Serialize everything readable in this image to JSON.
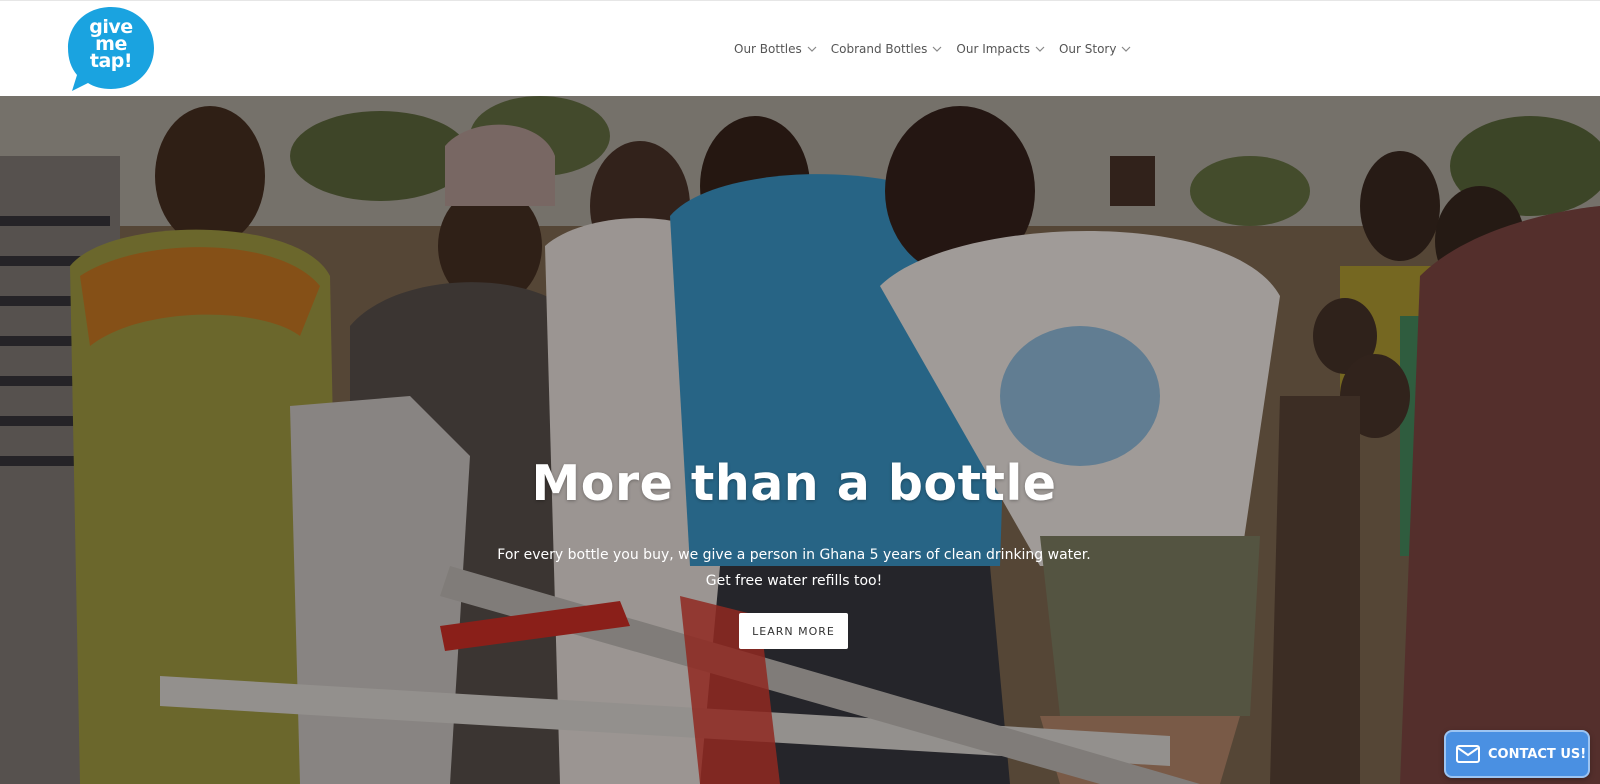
{
  "brand": {
    "logo_lines": [
      "give",
      "me",
      "tap!"
    ],
    "logo_color": "#1aa3e0"
  },
  "nav": {
    "items": [
      {
        "label": "Our Bottles",
        "icon": "chevron-down-icon"
      },
      {
        "label": "Cobrand Bottles",
        "icon": "chevron-down-icon"
      },
      {
        "label": "Our Impacts",
        "icon": "chevron-down-icon"
      },
      {
        "label": "Our Story",
        "icon": "chevron-down-icon"
      }
    ]
  },
  "hero": {
    "title": "More than a bottle",
    "subtitle_lines": [
      "For every bottle you buy, we give a person in Ghana 5 years of clean drinking water.",
      "Get free water refills too!"
    ],
    "cta_label": "LEARN MORE"
  },
  "contact": {
    "label": "CONTACT US!",
    "icon": "mail-icon",
    "color": "#4a90e2"
  }
}
